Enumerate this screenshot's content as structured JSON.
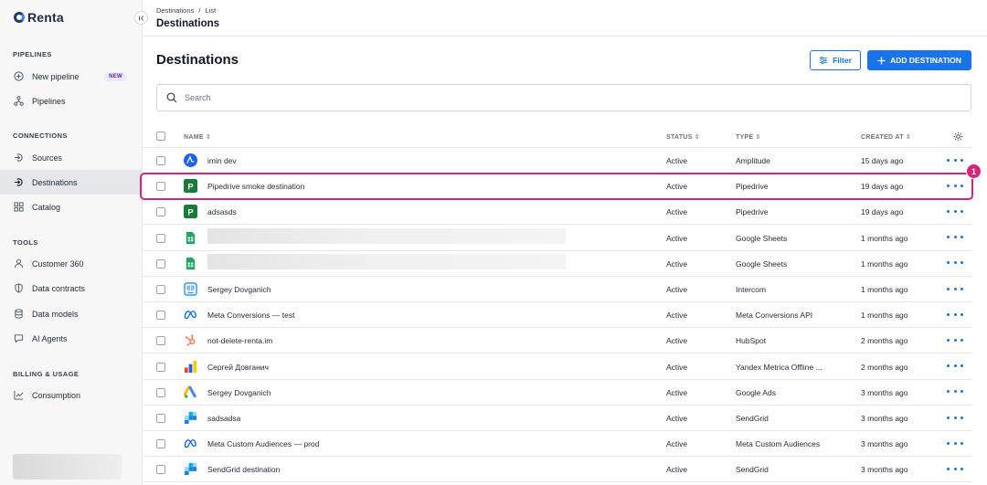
{
  "app": {
    "name": "Renta"
  },
  "sidebar": {
    "sections": [
      {
        "title": "PIPELINES"
      },
      {
        "title": "CONNECTIONS"
      },
      {
        "title": "TOOLS"
      },
      {
        "title": "BILLING & USAGE"
      }
    ],
    "items": [
      {
        "label": "New pipeline",
        "icon": "plus-circle-icon",
        "badge": "NEW"
      },
      {
        "label": "Pipelines",
        "icon": "pipelines-icon"
      },
      {
        "label": "Sources",
        "icon": "sources-icon"
      },
      {
        "label": "Destinations",
        "icon": "destinations-icon",
        "active": true
      },
      {
        "label": "Catalog",
        "icon": "catalog-icon"
      },
      {
        "label": "Customer 360",
        "icon": "user-icon"
      },
      {
        "label": "Data contracts",
        "icon": "shield-icon"
      },
      {
        "label": "Data models",
        "icon": "database-icon"
      },
      {
        "label": "AI Agents",
        "icon": "chat-icon"
      },
      {
        "label": "Consumption",
        "icon": "chart-line-icon"
      }
    ]
  },
  "header": {
    "breadcrumb": [
      "Destinations",
      "List"
    ],
    "breadcrumb_sep": "/",
    "title": "Destinations"
  },
  "main": {
    "title": "Destinations",
    "filter_label": "Filter",
    "add_label": "ADD DESTINATION",
    "search_placeholder": "Search"
  },
  "table": {
    "columns": {
      "name": "NAME",
      "status": "STATUS",
      "type": "TYPE",
      "created": "CREATED AT"
    },
    "rows": [
      {
        "name": "imin dev",
        "status": "Active",
        "type": "Amplitude",
        "created": "15 days ago",
        "logo": "amplitude"
      },
      {
        "name": "Pipedrive smoke destination",
        "status": "Active",
        "type": "Pipedrive",
        "created": "19 days ago",
        "logo": "pipedrive"
      },
      {
        "name": "adsasds",
        "status": "Active",
        "type": "Pipedrive",
        "created": "19 days ago",
        "logo": "pipedrive"
      },
      {
        "name": "",
        "status": "Active",
        "type": "Google Sheets",
        "created": "1 months ago",
        "logo": "sheets",
        "redacted": true
      },
      {
        "name": "",
        "status": "Active",
        "type": "Google Sheets",
        "created": "1 months ago",
        "logo": "sheets",
        "redacted": true
      },
      {
        "name": "Sergey Dovganich",
        "status": "Active",
        "type": "Intercom",
        "created": "1 months ago",
        "logo": "intercom"
      },
      {
        "name": "Meta Conversions — test",
        "status": "Active",
        "type": "Meta Conversions API",
        "created": "1 months ago",
        "logo": "meta"
      },
      {
        "name": "not-delete-renta.im",
        "status": "Active",
        "type": "HubSpot",
        "created": "2 months ago",
        "logo": "hubspot"
      },
      {
        "name": "Сергей Довганич",
        "status": "Active",
        "type": "Yandex Metrica Offline ...",
        "created": "2 months ago",
        "logo": "yandex"
      },
      {
        "name": "Sergey Dovganich",
        "status": "Active",
        "type": "Google Ads",
        "created": "3 months ago",
        "logo": "googleads"
      },
      {
        "name": "sadsadsa",
        "status": "Active",
        "type": "SendGrid",
        "created": "3 months ago",
        "logo": "sendgrid"
      },
      {
        "name": "Meta Custom Audiences — prod",
        "status": "Active",
        "type": "Meta Custom Audiences",
        "created": "3 months ago",
        "logo": "meta"
      },
      {
        "name": "SendGrid destination",
        "status": "Active",
        "type": "SendGrid",
        "created": "3 months ago",
        "logo": "sendgrid"
      }
    ]
  },
  "annotation": {
    "marker_label": "1",
    "color": "#d6247a"
  },
  "colors": {
    "accent": "#1a73e8",
    "highlight": "#d6247a"
  }
}
